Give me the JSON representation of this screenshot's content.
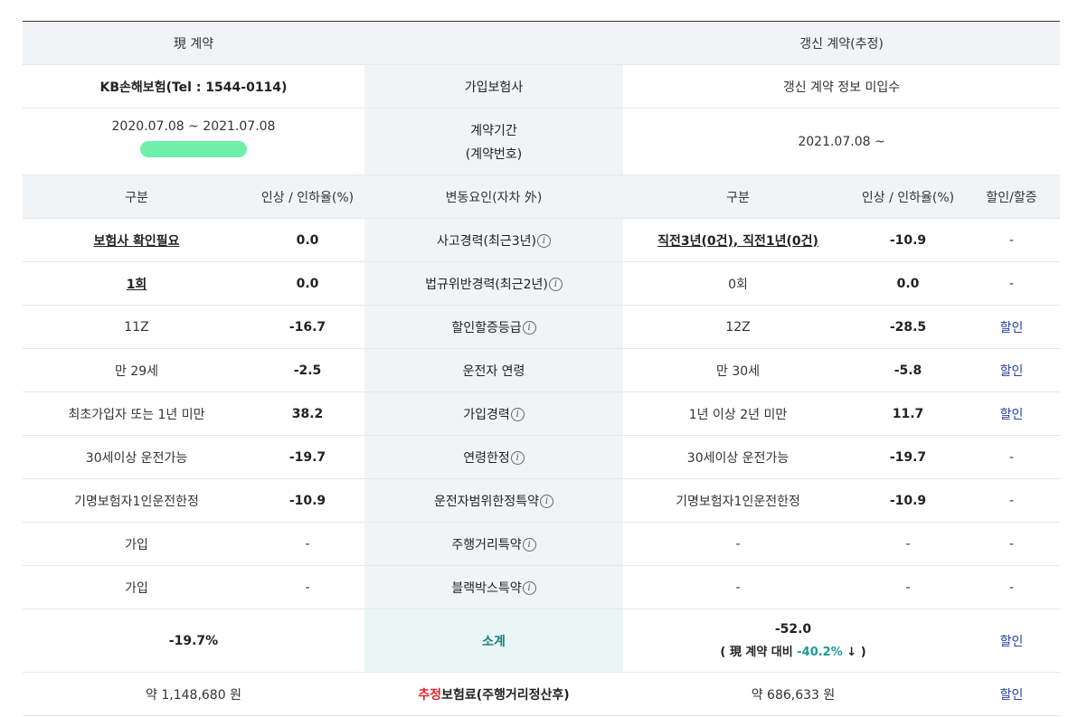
{
  "header": {
    "current": "現 계약",
    "renewal": "갱신 계약(추정)"
  },
  "insurer": {
    "current": "KB손해보험(Tel : 1544-0114)",
    "label": "가입보험사",
    "renewal": "갱신 계약 정보 미입수"
  },
  "period": {
    "current": "2020.07.08 ~ 2021.07.08",
    "label_line1": "계약기간",
    "label_line2": "(계약번호)",
    "renewal": "2021.07.08 ~"
  },
  "columns": {
    "cur_category": "구분",
    "cur_rate": "인상 / 인하율(%)",
    "factor": "변동요인(자차 外)",
    "new_category": "구분",
    "new_rate": "인상 / 인하율(%)",
    "discount": "할인/할증"
  },
  "info_glyph": "i",
  "rows": [
    {
      "cur": "보험사 확인필요",
      "cur_rate": "0.0",
      "factor": "사고경력(최근3년)",
      "new": "직전3년(0건), 직전1년(0건)",
      "new_rate": "-10.9",
      "disc": "-"
    },
    {
      "cur": "1회",
      "cur_rate": "0.0",
      "factor": "법규위반경력(최근2년)",
      "new": "0회",
      "new_rate": "0.0",
      "disc": "-"
    },
    {
      "cur": "11Z",
      "cur_rate": "-16.7",
      "factor": "할인할증등급",
      "new": "12Z",
      "new_rate": "-28.5",
      "disc": "할인"
    },
    {
      "cur": "만 29세",
      "cur_rate": "-2.5",
      "factor": "운전자 연령",
      "new": "만 30세",
      "new_rate": "-5.8",
      "disc": "할인"
    },
    {
      "cur": "최초가입자 또는 1년 미만",
      "cur_rate": "38.2",
      "factor": "가입경력",
      "new": "1년 이상 2년 미만",
      "new_rate": "11.7",
      "disc": "할인"
    },
    {
      "cur": "30세이상 운전가능",
      "cur_rate": "-19.7",
      "factor": "연령한정",
      "new": "30세이상 운전가능",
      "new_rate": "-19.7",
      "disc": "-"
    },
    {
      "cur": "기명보험자1인운전한정",
      "cur_rate": "-10.9",
      "factor": "운전자범위한정특약",
      "new": "기명보험자1인운전한정",
      "new_rate": "-10.9",
      "disc": "-"
    },
    {
      "cur": "가입",
      "cur_rate": "-",
      "factor": "주행거리특약",
      "new": "-",
      "new_rate": "-",
      "disc": "-"
    },
    {
      "cur": "가입",
      "cur_rate": "-",
      "factor": "블랙박스특약",
      "new": "-",
      "new_rate": "-",
      "disc": "-"
    }
  ],
  "subtotal": {
    "current": "-19.7%",
    "label": "소계",
    "renewal": "-52.0",
    "compare_prefix": "( 現 계약 대비 ",
    "compare_value": "-40.2%",
    "compare_suffix": " ↓ )",
    "disc": "할인"
  },
  "premium": {
    "current": "약 1,148,680 원",
    "label_red": "추정",
    "label_rest": "보험료(주행거리정산후)",
    "renewal": "약 686,633 원",
    "disc": "할인"
  },
  "colors": {
    "accent": "#1c9a9a",
    "link": "#2443a8",
    "red": "#e3262a",
    "header_bg": "#f1f4f7"
  }
}
